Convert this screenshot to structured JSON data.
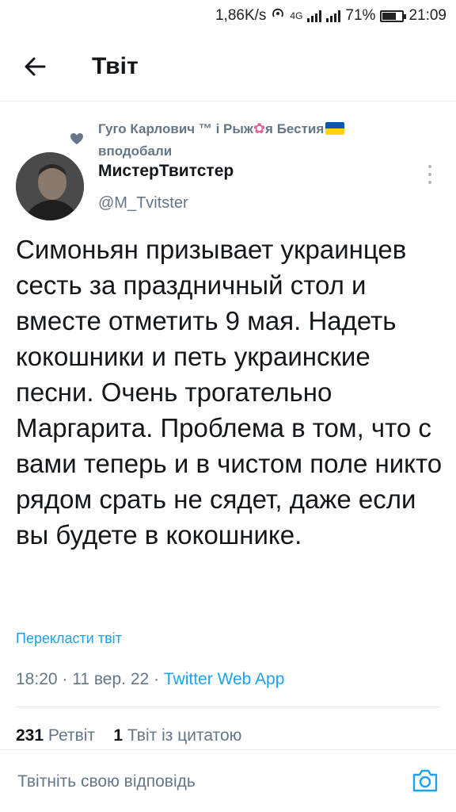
{
  "status_bar": {
    "speed": "1,86K/s",
    "network": "4G",
    "battery_percent": "71%",
    "battery_level": 0.71,
    "time": "21:09"
  },
  "header": {
    "title": "Твіт",
    "back_icon": "arrow-left-icon"
  },
  "liked_by": {
    "name_part1": "Гуго Карлович ™ і Рыж",
    "name_part2": "я Бестия",
    "flower": "✿",
    "suffix": "вподобали",
    "icon": "heart-icon"
  },
  "author": {
    "name": "МистерТвитстер",
    "handle": "@M_Tvitster"
  },
  "tweet": {
    "text": "Симоньян призывает украинцев сесть за праздничный стол и вместе отметить 9 мая. Надеть кокошники и петь украинские песни. Очень трогательно Маргарита. Проблема в том, что с вами теперь и в чистом поле никто рядом срать не сядет, даже если вы будете в кокошнике.",
    "translate_label": "Перекласти твіт",
    "time": "18:20",
    "date": "11 вер. 22",
    "separator": "·",
    "source": "Twitter Web App"
  },
  "stats": {
    "retweets_count": "231",
    "retweets_label": "Ретвіт",
    "quotes_count": "1",
    "quotes_label": "Твіт із цитатою"
  },
  "reply": {
    "placeholder": "Твітніть свою відповідь",
    "camera_icon": "camera-icon"
  },
  "colors": {
    "accent": "#1da1f2",
    "secondary_text": "#657786",
    "primary_text": "#14171a",
    "divider": "#e6ecf0"
  }
}
